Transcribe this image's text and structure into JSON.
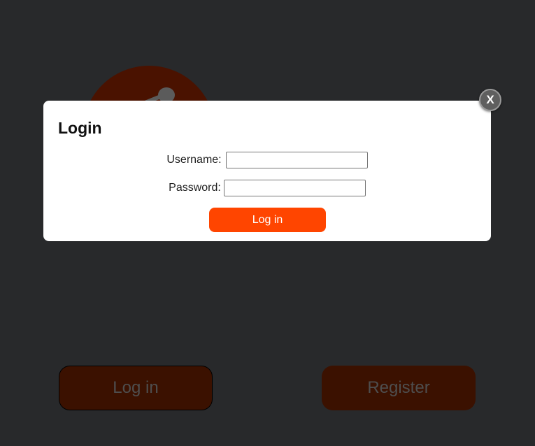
{
  "background": {
    "login_button": "Log in",
    "register_button": "Register",
    "logo_icon": "joystick-logo-icon"
  },
  "modal": {
    "title": "Login",
    "username_label": "Username:",
    "username_value": "",
    "password_label": "Password:",
    "password_value": "",
    "submit_label": "Log in",
    "close_label": "X"
  },
  "colors": {
    "page_background": "#28292b",
    "accent": "#ff4500",
    "dim_button": "#3b1100"
  }
}
